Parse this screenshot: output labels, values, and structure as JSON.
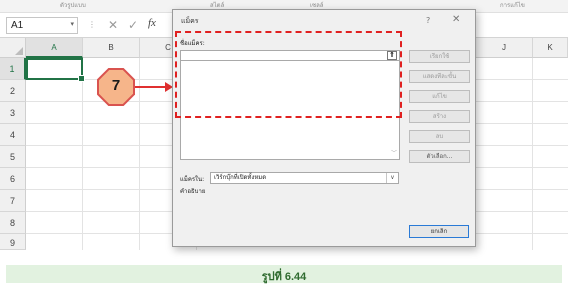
{
  "ribbon": {
    "fragments": [
      "ตัวรูปแบบ",
      "สไตล์",
      "เซลล์",
      "การแก้ไข"
    ]
  },
  "formula_bar": {
    "name_box": "A1",
    "cancel_glyph": "✕",
    "enter_glyph": "✓",
    "fx_label": "fx"
  },
  "grid": {
    "columns": [
      "A",
      "B",
      "C",
      "J",
      "K"
    ],
    "rows": [
      "1",
      "2",
      "3",
      "4",
      "5",
      "6",
      "7",
      "8",
      "9"
    ]
  },
  "callout": {
    "number": "7"
  },
  "dialog": {
    "title": "แม็คร",
    "help": "?",
    "close": "✕",
    "list_label": "ชื่อแม็คร:",
    "list_up_button": "⇑",
    "buttons": [
      "เรียกใช้",
      "แสดงทีละขั้น",
      "แก้ไข",
      "สร้าง",
      "ลบ",
      "ตัวเลือก..."
    ],
    "scope_label": "แม็ครใน:",
    "scope_value": "เวิร์กบุ๊กที่เปิดทั้งหมด",
    "description_label": "คำอธิบาย",
    "cancel": "ยกเลิก"
  },
  "caption": "รูปที่ 6.44"
}
